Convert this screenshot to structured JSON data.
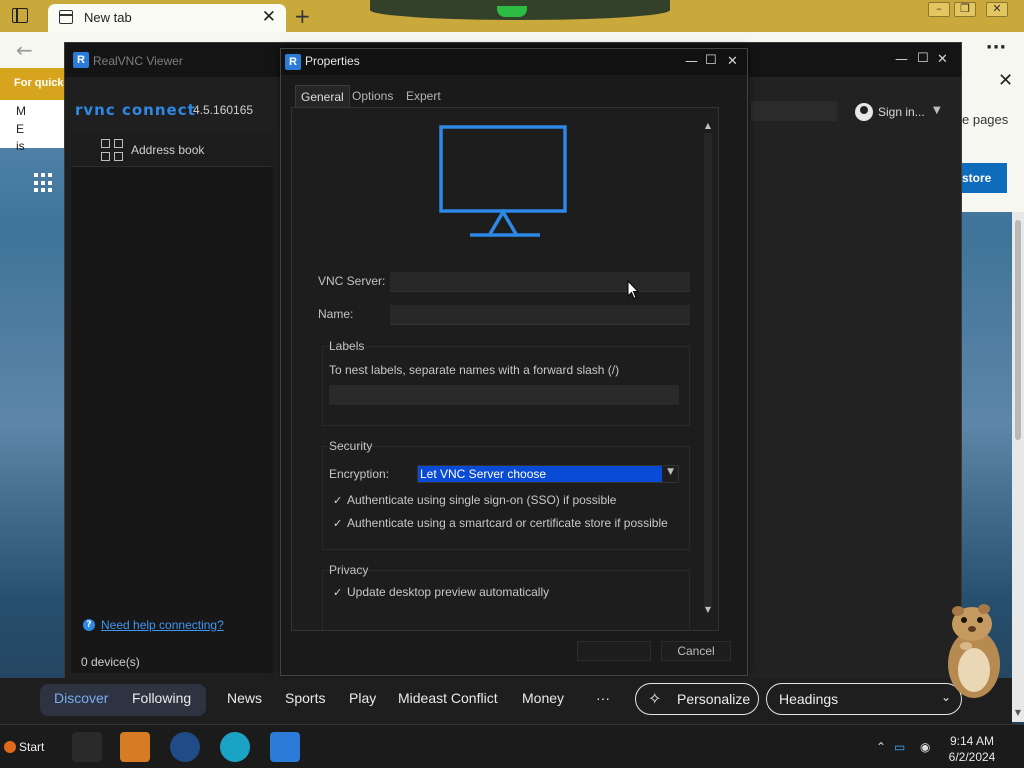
{
  "browser": {
    "tab_title": "New tab",
    "tab_close": "✕",
    "new_tab": "+",
    "back": "←",
    "more": "···",
    "quick_strip": "For quick",
    "left_letters": [
      "M",
      "E",
      "is"
    ],
    "right_close": "✕",
    "right_pages": "e pages",
    "right_store": "store"
  },
  "vnc": {
    "window_title": "RealVNC Viewer",
    "brand": "RVNC CONNECT",
    "version": "4.5.160165",
    "address_book": "Address book",
    "help_link": "Need help connecting?",
    "devices": "0 device(s)",
    "sign_in": "Sign in...",
    "window_min": "—",
    "window_max": "☐",
    "window_close": "✕"
  },
  "dialog": {
    "title": "Properties",
    "tabs": [
      "General",
      "Options",
      "Expert"
    ],
    "active_tab": "General",
    "vnc_server_label": "VNC Server:",
    "name_label": "Name:",
    "labels_title": "Labels",
    "labels_hint": "To nest labels, separate names with a forward slash (/)",
    "security_title": "Security",
    "encryption_label": "Encryption:",
    "encryption_value": "Let VNC Server choose",
    "sso_label": "Authenticate using single sign-on (SSO) if possible",
    "smartcard_label": "Authenticate using a smartcard or certificate store if possible",
    "privacy_title": "Privacy",
    "preview_label": "Update desktop preview automatically",
    "cancel": "Cancel",
    "checked_mark": "✓",
    "accent": "#2d88e6",
    "selection": "#0a4bd6"
  },
  "news": {
    "items": [
      "Discover",
      "Following",
      "News",
      "Sports",
      "Play",
      "Mideast Conflict",
      "Money",
      "···"
    ],
    "personalize": "Personalize",
    "headings": "Headings"
  },
  "taskbar": {
    "start": "Start",
    "time": "9:14 AM",
    "date": "6/2/2024"
  }
}
